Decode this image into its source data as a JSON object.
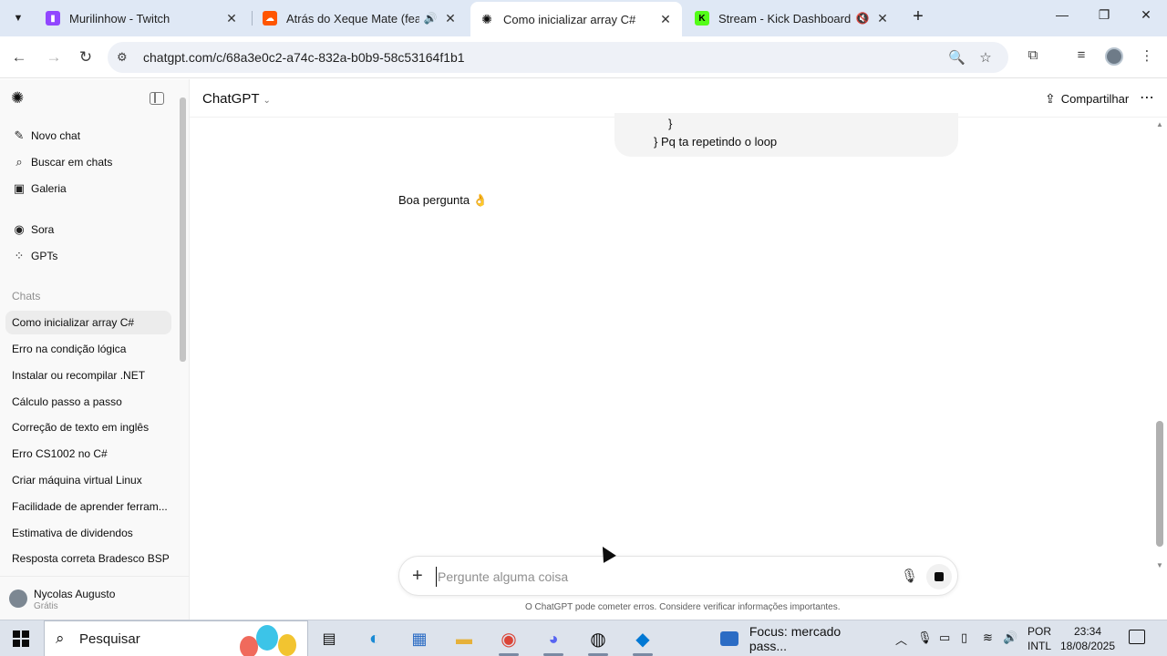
{
  "browser": {
    "tabs": [
      {
        "title": "Murilinhow - Twitch",
        "favicon": "twitch-icon",
        "color": "#9146ff"
      },
      {
        "title": "Atrás do Xeque Mate (feat. ",
        "favicon": "soundcloud-icon",
        "color": "#ff5500"
      },
      {
        "title": "Como inicializar array C#",
        "favicon": "chatgpt-icon",
        "color": "#0d0d0d"
      },
      {
        "title": "Stream - Kick Dashboard",
        "favicon": "kick-icon",
        "color": "#53fc18"
      }
    ],
    "url": "chatgpt.com/c/68a3e0c2-a74c-832a-b0b9-58c53164f1b1"
  },
  "sidebar": {
    "nav": [
      {
        "label": "Novo chat",
        "icon": "edit-icon"
      },
      {
        "label": "Buscar em chats",
        "icon": "search-icon"
      },
      {
        "label": "Galeria",
        "icon": "gallery-icon"
      },
      {
        "label": "Sora",
        "icon": "sora-icon"
      },
      {
        "label": "GPTs",
        "icon": "gpts-icon"
      }
    ],
    "section_label": "Chats",
    "chats": [
      "Como inicializar array C#",
      "Erro na condição lógica",
      "Instalar ou recompilar .NET",
      "Cálculo passo a passo",
      "Correção de texto em inglês",
      "Erro CS1002 no C#",
      "Criar máquina virtual Linux",
      "Facilidade de aprender ferram...",
      "Estimativa de dividendos",
      "Resposta correta Bradesco BSP"
    ],
    "user": {
      "name": "Nycolas Augusto",
      "plan": "Grátis"
    }
  },
  "header": {
    "model": "ChatGPT",
    "share_label": "Compartilhar"
  },
  "conversation": {
    "user_code_line1": "}",
    "user_code_line2": "} Pq ta repetindo o loop",
    "assistant_text": "Boa pergunta 👌"
  },
  "composer": {
    "placeholder": "Pergunte alguma coisa",
    "disclaimer": "O ChatGPT pode cometer erros. Considere verificar informações importantes."
  },
  "taskbar": {
    "search_label": "Pesquisar",
    "media_label": "Focus: mercado pass...",
    "lang_line1": "POR",
    "lang_line2": "INTL",
    "time": "23:34",
    "date": "18/08/2025"
  }
}
